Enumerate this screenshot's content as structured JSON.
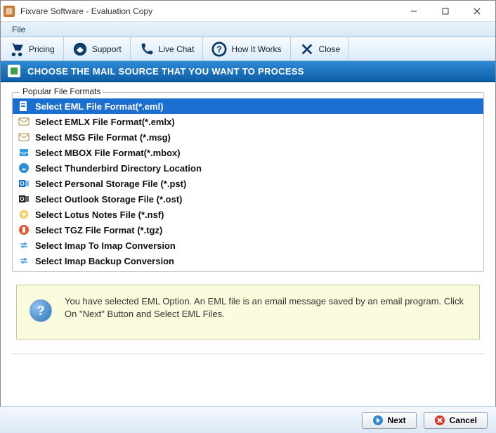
{
  "window": {
    "title": "Fixvare Software - Evaluation Copy"
  },
  "menubar": {
    "file": "File"
  },
  "toolbar": {
    "pricing": "Pricing",
    "support": "Support",
    "live_chat": "Live Chat",
    "how_it_works": "How It Works",
    "close": "Close"
  },
  "banner": {
    "text": "CHOOSE THE MAIL SOURCE THAT YOU WANT TO PROCESS"
  },
  "group": {
    "legend": "Popular File Formats",
    "formats": [
      {
        "label": "Select EML File Format(*.eml)",
        "icon": "doc-icon",
        "selected": true
      },
      {
        "label": "Select EMLX File Format(*.emlx)",
        "icon": "mail-icon",
        "selected": false
      },
      {
        "label": "Select MSG File Format (*.msg)",
        "icon": "mail-icon",
        "selected": false
      },
      {
        "label": "Select MBOX File Format(*.mbox)",
        "icon": "inbox-icon",
        "selected": false
      },
      {
        "label": "Select Thunderbird Directory Location",
        "icon": "thunderbird-icon",
        "selected": false
      },
      {
        "label": "Select Personal Storage File (*.pst)",
        "icon": "outlook-icon",
        "selected": false
      },
      {
        "label": "Select Outlook Storage File (*.ost)",
        "icon": "outlook-dark-icon",
        "selected": false
      },
      {
        "label": "Select Lotus Notes File (*.nsf)",
        "icon": "lotus-icon",
        "selected": false
      },
      {
        "label": "Select TGZ File Format (*.tgz)",
        "icon": "archive-icon",
        "selected": false
      },
      {
        "label": "Select Imap To Imap Conversion",
        "icon": "swap-icon",
        "selected": false
      },
      {
        "label": "Select Imap Backup Conversion",
        "icon": "swap-icon",
        "selected": false
      }
    ]
  },
  "info": {
    "message": "You have selected EML Option. An EML file is an email message saved by an email program. Click On \"Next\" Button and Select EML Files."
  },
  "footer": {
    "next": "Next",
    "cancel": "Cancel"
  }
}
